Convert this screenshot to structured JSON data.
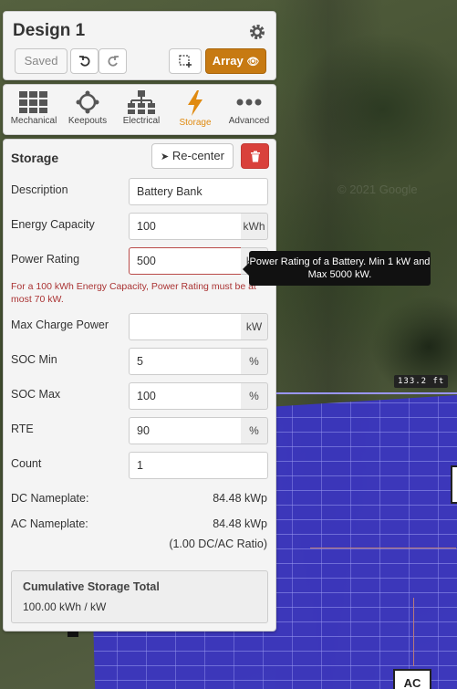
{
  "map": {
    "dimension_label": "133.2 ft",
    "ac_label": "AC"
  },
  "header": {
    "title": "Design 1",
    "saved_label": "Saved",
    "array_label": "Array"
  },
  "tools": [
    {
      "label": "Mechanical",
      "icon": "grid-icon"
    },
    {
      "label": "Keepouts",
      "icon": "keepout-icon"
    },
    {
      "label": "Electrical",
      "icon": "electrical-tree-icon"
    },
    {
      "label": "Storage",
      "icon": "lightning-icon",
      "active": true
    },
    {
      "label": "Advanced",
      "icon": "more-dots-icon"
    }
  ],
  "storage": {
    "title": "Storage",
    "recenter_label": "Re-center",
    "fields": {
      "description": {
        "label": "Description",
        "value": "Battery Bank"
      },
      "energy_capacity": {
        "label": "Energy Capacity",
        "value": "100",
        "unit": "kWh"
      },
      "power_rating": {
        "label": "Power Rating",
        "value": "500",
        "unit": "kW"
      },
      "max_charge_power": {
        "label": "Max Charge Power",
        "value": "",
        "unit": "kW"
      },
      "soc_min": {
        "label": "SOC Min",
        "value": "5",
        "unit": "%"
      },
      "soc_max": {
        "label": "SOC Max",
        "value": "100",
        "unit": "%"
      },
      "rte": {
        "label": "RTE",
        "value": "90",
        "unit": "%"
      },
      "count": {
        "label": "Count",
        "value": "1"
      }
    },
    "error": "For a 100 kWh Energy Capacity, Power Rating must be at most 70 kW.",
    "dc_nameplate": {
      "label": "DC Nameplate:",
      "value": "84.48 kWp"
    },
    "ac_nameplate": {
      "label": "AC Nameplate:",
      "value": "84.48 kWp"
    },
    "ratio": "(1.00 DC/AC Ratio)",
    "cumulative": {
      "title": "Cumulative Storage Total",
      "value": "100.00 kWh /  kW"
    }
  },
  "tooltip": "Power Rating of a Battery. Min 1 kW and Max 5000 kW.",
  "colors": {
    "accent": "#c77a12",
    "active_tool": "#e08a10",
    "danger": "#d9413b",
    "error_text": "#aa3333"
  }
}
